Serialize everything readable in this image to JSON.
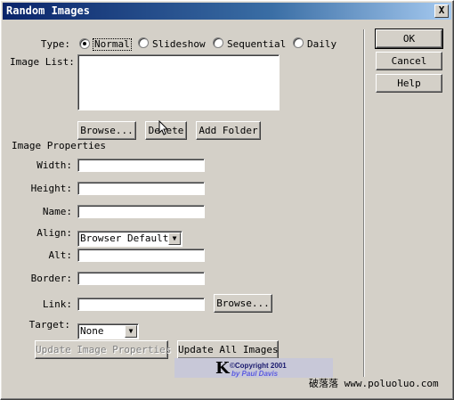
{
  "window": {
    "title": "Random Images",
    "close_glyph": "X"
  },
  "type": {
    "label": "Type:",
    "options": [
      {
        "label": "Normal",
        "selected": true
      },
      {
        "label": "Slideshow",
        "selected": false
      },
      {
        "label": "Sequential",
        "selected": false
      },
      {
        "label": "Daily",
        "selected": false
      }
    ]
  },
  "image_list": {
    "label": "Image List:"
  },
  "list_buttons": {
    "browse": "Browse...",
    "delete": "Delete",
    "add_folder": "Add Folder"
  },
  "properties": {
    "heading": "Image Properties",
    "width_label": "Width:",
    "height_label": "Height:",
    "name_label": "Name:",
    "align_label": "Align:",
    "align_value": "Browser Default",
    "alt_label": "Alt:",
    "border_label": "Border:",
    "link_label": "Link:",
    "link_browse": "Browse...",
    "target_label": "Target:",
    "target_value": "None"
  },
  "bottom_buttons": {
    "update_image": "Update Image Properties",
    "update_all": "Update All Images"
  },
  "side_buttons": {
    "ok": "OK",
    "cancel": "Cancel",
    "help": "Help"
  },
  "banner": {
    "k": "K",
    "line1": "©Copyright 2001",
    "line2": "by Paul Davis"
  },
  "watermark": "破落落  www.poluoluo.com"
}
